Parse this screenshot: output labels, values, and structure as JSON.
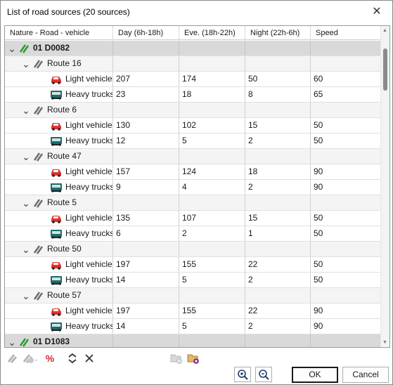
{
  "window": {
    "title": "List of road sources (20 sources)",
    "close_glyph": "✕"
  },
  "columns": [
    "Nature - Road - vehicle",
    "Day (6h-18h)",
    "Eve. (18h-22h)",
    "Night (22h-6h)",
    "Speed"
  ],
  "rows": [
    {
      "kind": "group",
      "label": "01 D0082"
    },
    {
      "kind": "route",
      "label": "Route 16"
    },
    {
      "kind": "vehicle",
      "vtype": "light",
      "label": "Light vehicles",
      "day": "207",
      "eve": "174",
      "night": "50",
      "speed": "60"
    },
    {
      "kind": "vehicle",
      "vtype": "heavy",
      "label": "Heavy trucks",
      "day": "23",
      "eve": "18",
      "night": "8",
      "speed": "65"
    },
    {
      "kind": "route",
      "label": "Route 6"
    },
    {
      "kind": "vehicle",
      "vtype": "light",
      "label": "Light vehicles",
      "day": "130",
      "eve": "102",
      "night": "15",
      "speed": "50"
    },
    {
      "kind": "vehicle",
      "vtype": "heavy",
      "label": "Heavy trucks",
      "day": "12",
      "eve": "5",
      "night": "2",
      "speed": "50"
    },
    {
      "kind": "route",
      "label": "Route 47"
    },
    {
      "kind": "vehicle",
      "vtype": "light",
      "label": "Light vehicles",
      "day": "157",
      "eve": "124",
      "night": "18",
      "speed": "90"
    },
    {
      "kind": "vehicle",
      "vtype": "heavy",
      "label": "Heavy trucks",
      "day": "9",
      "eve": "4",
      "night": "2",
      "speed": "90"
    },
    {
      "kind": "route",
      "label": "Route 5"
    },
    {
      "kind": "vehicle",
      "vtype": "light",
      "label": "Light vehicles",
      "day": "135",
      "eve": "107",
      "night": "15",
      "speed": "50"
    },
    {
      "kind": "vehicle",
      "vtype": "heavy",
      "label": "Heavy trucks",
      "day": "6",
      "eve": "2",
      "night": "1",
      "speed": "50"
    },
    {
      "kind": "route",
      "label": "Route 50"
    },
    {
      "kind": "vehicle",
      "vtype": "light",
      "label": "Light vehicles",
      "day": "197",
      "eve": "155",
      "night": "22",
      "speed": "50"
    },
    {
      "kind": "vehicle",
      "vtype": "heavy",
      "label": "Heavy trucks",
      "day": "14",
      "eve": "5",
      "night": "2",
      "speed": "50"
    },
    {
      "kind": "route",
      "label": "Route 57"
    },
    {
      "kind": "vehicle",
      "vtype": "light",
      "label": "Light vehicles",
      "day": "197",
      "eve": "155",
      "night": "22",
      "speed": "90"
    },
    {
      "kind": "vehicle",
      "vtype": "heavy",
      "label": "Heavy trucks",
      "day": "14",
      "eve": "5",
      "night": "2",
      "speed": "90"
    },
    {
      "kind": "group",
      "label": "01 D1083"
    }
  ],
  "icons": {
    "group": "road-group-icon",
    "route": "road-icon",
    "light": "car-icon",
    "heavy": "truck-icon"
  },
  "colors": {
    "group_bg": "#d9d9d9",
    "road_green": "#2e9b2e",
    "car_red": "#e03232",
    "truck_teal": "#1f6b6b",
    "percent_red": "#d32f2f",
    "add_purple": "#7a2a8a"
  },
  "toolbar": {
    "percent_glyph": "%",
    "expand_glyph": "⌃⌄",
    "collapse_glyph": "✕"
  },
  "buttons": {
    "ok": "OK",
    "cancel": "Cancel"
  }
}
